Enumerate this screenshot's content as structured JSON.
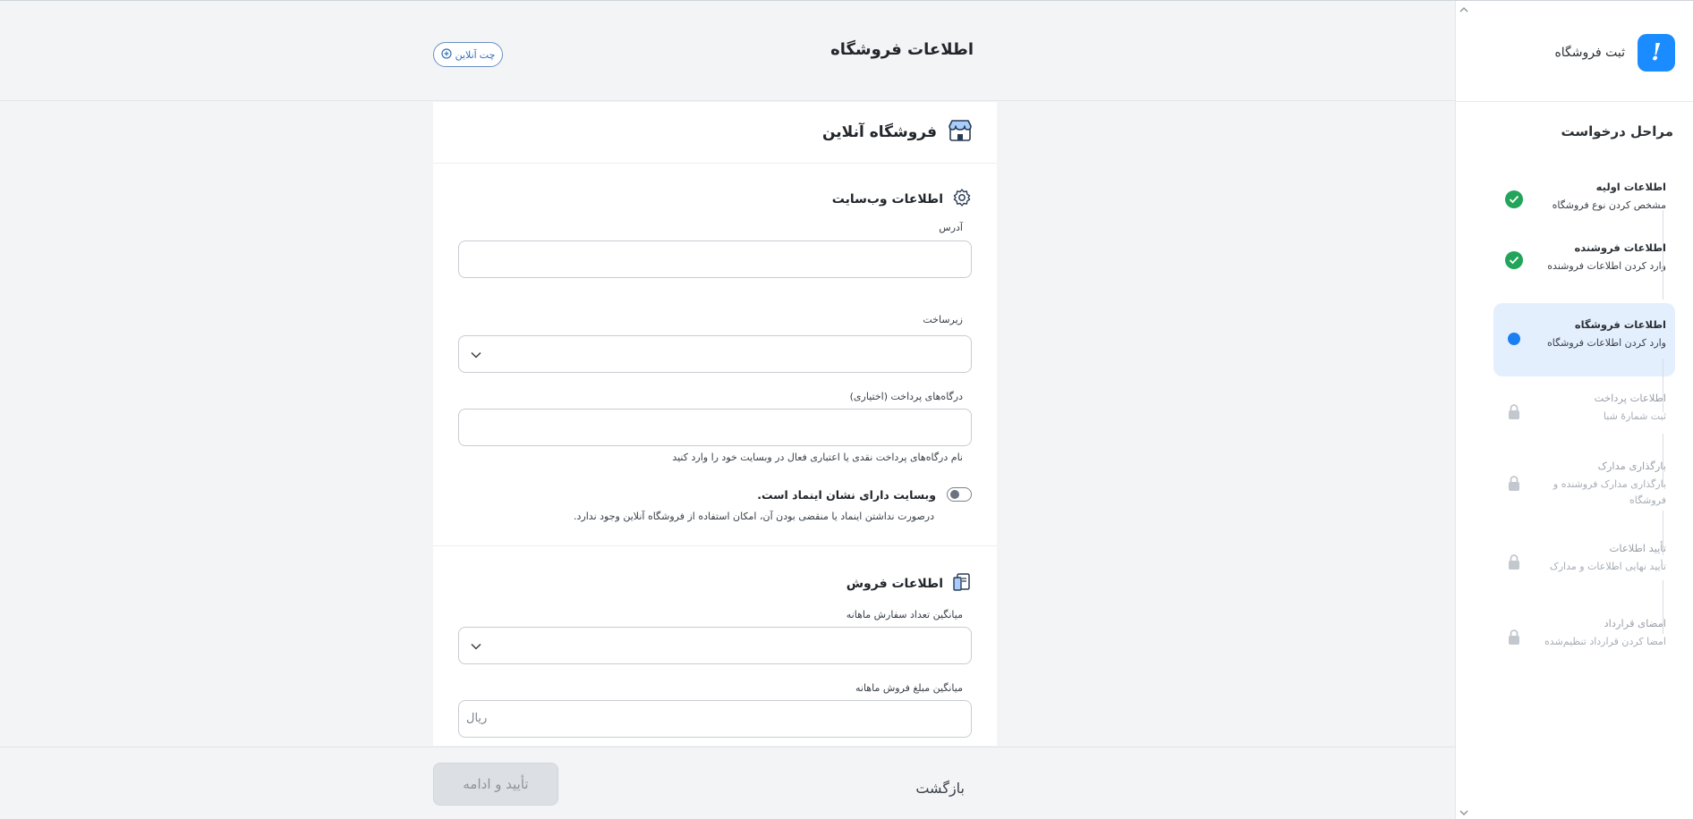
{
  "header": {
    "title": "اطلاعات فروشگاه",
    "chat_label": "چت آنلاین"
  },
  "sidebar": {
    "brand_title": "ثبت فروشگاه",
    "brand_logo_glyph": "!",
    "steps_heading": "مراحل درخواست",
    "steps": [
      {
        "title": "اطلاعات اولیه",
        "desc": "مشخص کردن نوع فروشگاه",
        "status": "done"
      },
      {
        "title": "اطلاعات فروشنده",
        "desc": "وارد کردن اطلاعات فروشنده",
        "status": "done"
      },
      {
        "title": "اطلاعات فروشگاه",
        "desc": "وارد کردن اطلاعات فروشگاه",
        "status": "active"
      },
      {
        "title": "اطلاعات پرداخت",
        "desc": "ثبت شمارهٔ شبا",
        "status": "locked"
      },
      {
        "title": "بارگذاری مدارک",
        "desc": "بارگذاری مدارک فروشنده و فروشگاه",
        "status": "locked"
      },
      {
        "title": "تأیید اطلاعات",
        "desc": "تأیید نهایی اطلاعات و مدارک",
        "status": "locked"
      },
      {
        "title": "امضای قرارداد",
        "desc": "امضا کردن قرارداد تنظیم‌شده",
        "status": "locked"
      }
    ]
  },
  "card": {
    "title": "فروشگاه آنلاین",
    "website_section": {
      "title": "اطلاعات وب‌سایت",
      "address_label": "آدرس",
      "address_value": "",
      "platform_label": "زیرساخت",
      "platform_value": "",
      "gateways_label": "درگاه‌های پرداخت (اختیاری)",
      "gateways_value": "",
      "gateways_hint": "نام درگاه‌های پرداخت نقدی یا اعتباری فعال در وبسایت خود را وارد کنید",
      "enamad_label": "وبسایت دارای نشان اینماد است.",
      "enamad_hint": "درصورت نداشتن اینماد یا منقضی بودن آن، امکان استفاده از فروشگاه آنلاین وجود ندارد.",
      "enamad_on": false
    },
    "sales_section": {
      "title": "اطلاعات فروش",
      "orders_label": "میانگین تعداد سفارش ماهانه",
      "orders_value": "",
      "amount_label": "میانگین مبلغ فروش ماهانه",
      "amount_value": "",
      "amount_unit": "ریال"
    }
  },
  "footer": {
    "back_label": "بازگشت",
    "confirm_label": "تأیید و ادامه"
  },
  "colors": {
    "accent": "#1a8cff",
    "done": "#22a55a",
    "active_bg": "#e4effd"
  }
}
